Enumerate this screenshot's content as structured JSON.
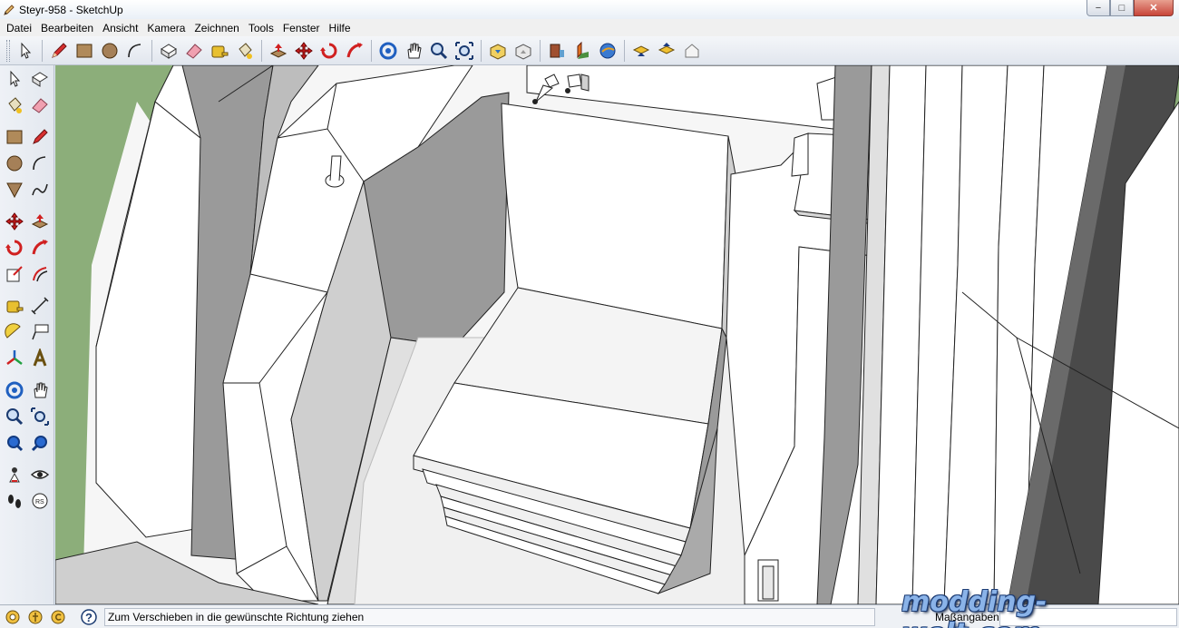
{
  "window": {
    "title": "Steyr-958 - SketchUp",
    "app_icon": "sketchup-pencil-icon",
    "controls": {
      "minimize": "−",
      "maximize": "□",
      "close": "✕"
    }
  },
  "menu": {
    "items": [
      "Datei",
      "Bearbeiten",
      "Ansicht",
      "Kamera",
      "Zeichnen",
      "Tools",
      "Fenster",
      "Hilfe"
    ]
  },
  "toolbar": {
    "tools": [
      "select-icon",
      "pencil-icon",
      "rectangle-icon",
      "circle-icon",
      "arc-icon",
      "make-component-icon",
      "eraser-icon",
      "tape-measure-icon",
      "paint-bucket-icon",
      "push-pull-icon",
      "move-icon",
      "rotate-icon",
      "follow-me-icon",
      "orbit-icon",
      "pan-icon",
      "zoom-icon",
      "zoom-extents-icon",
      "get-models-icon",
      "share-model-icon",
      "get-photo-texture-icon",
      "place-model-icon",
      "google-earth-icon",
      "download-icon",
      "upload-icon",
      "warehouse-icon"
    ]
  },
  "left_toolbar": {
    "tools": [
      "select-icon",
      "component-icon",
      "paint-bucket-icon",
      "eraser-icon",
      "rectangle-icon",
      "line-icon",
      "circle-icon",
      "arc-icon",
      "polygon-icon",
      "freehand-icon",
      "move-icon",
      "push-pull-icon",
      "rotate-icon",
      "follow-me-icon",
      "scale-icon",
      "offset-icon",
      "tape-measure-icon",
      "dimension-icon",
      "protractor-icon",
      "text-icon",
      "axes-icon",
      "3d-text-icon",
      "orbit-icon",
      "pan-icon",
      "zoom-icon",
      "zoom-window-icon",
      "zoom-extents-icon",
      "previous-view-icon",
      "position-camera-icon",
      "look-around-icon",
      "walk-icon",
      "section-plane-icon"
    ]
  },
  "status": {
    "message": "Zum Verschieben in die gewünschte Richtung ziehen",
    "measure_label": "Maßangaben",
    "measure_value": ""
  },
  "watermark": "modding-welt.com",
  "colors": {
    "viewport_bg": "#f4f4f4",
    "ground_green": "#8cae7a",
    "face_white": "#ffffff",
    "face_gray": "#9a9a9a",
    "dark_beam": "#4a4a4a"
  }
}
